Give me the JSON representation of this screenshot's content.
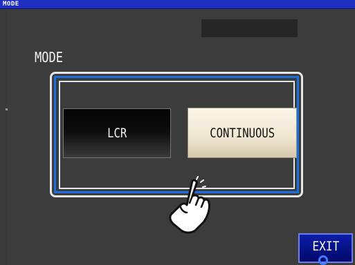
{
  "window": {
    "title": "MODE"
  },
  "screen": {
    "heading": "MODE",
    "options": [
      {
        "label": "LCR",
        "selected": false
      },
      {
        "label": "CONTINUOUS",
        "selected": true
      }
    ]
  },
  "footer": {
    "exit_label": "EXIT"
  },
  "icons": {
    "pointer": "pointing-hand-icon",
    "touch": "touch-point-icon"
  },
  "colors": {
    "title_bar": "#1f2fc2",
    "background": "#3c3c3c",
    "selection_frame": "#1d6fe0",
    "selected_button": "#efe5d0",
    "unselected_button": "#0c0c0c",
    "exit_button": "#0b1ca8"
  }
}
